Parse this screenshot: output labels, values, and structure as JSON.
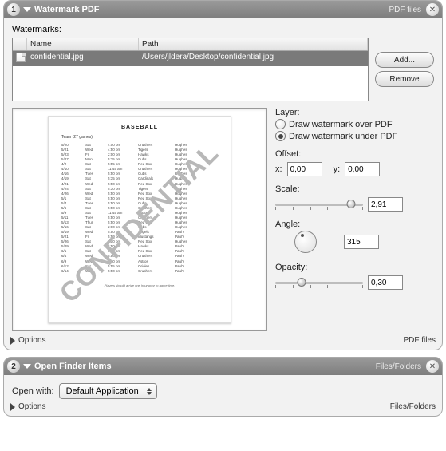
{
  "action1": {
    "step": "1",
    "title": "Watermark PDF",
    "type": "PDF files",
    "watermarks_label": "Watermarks:",
    "table": {
      "col_name": "Name",
      "col_path": "Path",
      "row": {
        "name": "confidential.jpg",
        "path": "/Users/jldera/Desktop/confidential.jpg"
      }
    },
    "buttons": {
      "add": "Add...",
      "remove": "Remove"
    },
    "layer": {
      "label": "Layer:",
      "over": "Draw watermark over PDF",
      "under": "Draw watermark under PDF",
      "selected": "under"
    },
    "offset": {
      "label": "Offset:",
      "x_label": "x:",
      "x": "0,00",
      "y_label": "y:",
      "y": "0,00"
    },
    "scale": {
      "label": "Scale:",
      "value": "2,91"
    },
    "angle": {
      "label": "Angle:",
      "value": "315"
    },
    "opacity": {
      "label": "Opacity:",
      "value": "0,30"
    },
    "options": "Options",
    "footer_type": "PDF files",
    "preview": {
      "title": "BASEBALL",
      "subtitle": "Team (27 games)",
      "watermark": "CONFIDENTIAL",
      "footnote": "Players should arrive one hour prior to game time.",
      "schedule": [
        [
          "5/20",
          "Sat",
          "4:00 pm",
          "Crushers",
          "Hughes"
        ],
        [
          "5/21",
          "Wed",
          "4:50 pm",
          "Tigers",
          "Hughes"
        ],
        [
          "5/23",
          "Fri",
          "2:00 pm",
          "Hawks",
          "Hughes"
        ],
        [
          "5/27",
          "Mon",
          "5:35 pm",
          "Cubs",
          "Hughes"
        ],
        [
          "4/2",
          "Sat",
          "5:55 pm",
          "Red Sox",
          "Hughes"
        ],
        [
          "4/10",
          "Sat",
          "11:45 am",
          "Crushers",
          "Hughes"
        ],
        [
          "4/16",
          "Tues",
          "5:50 pm",
          "Cubs",
          "Hughes"
        ],
        [
          "4/19",
          "Sat",
          "5:35 pm",
          "Cardinals",
          "Hughes"
        ],
        [
          "4/21",
          "Wed",
          "5:50 pm",
          "Red Sox",
          "Hughes"
        ],
        [
          "4/24",
          "Sat",
          "5:30 pm",
          "Tigers",
          "Hughes"
        ],
        [
          "4/26",
          "Wed",
          "5:50 pm",
          "Red Sox",
          "Hughes"
        ],
        [
          "5/1",
          "Sat",
          "5:50 pm",
          "Red Sox",
          "Hughes"
        ],
        [
          "5/4",
          "Tues",
          "5:50 pm",
          "Cubs",
          "Hughes"
        ],
        [
          "5/6",
          "Sat",
          "5:50 pm",
          "Crushers",
          "Hughes"
        ],
        [
          "5/9",
          "Sat",
          "11:45 am",
          "Astros",
          "Hughes"
        ],
        [
          "5/11",
          "Tues",
          "5:50 pm",
          "Crushers",
          "Hughes"
        ],
        [
          "5/13",
          "Thur",
          "5:50 pm",
          "Red Sox",
          "Hughes"
        ],
        [
          "5/16",
          "Sat",
          "2:00 pm",
          "Cubs",
          "Hughes"
        ],
        [
          "5/19",
          "Wed",
          "5:50 pm",
          "Angels",
          "Paul's"
        ],
        [
          "5/21",
          "Fri",
          "5:50 pm",
          "Mustangs",
          "Paul's"
        ],
        [
          "5/26",
          "Sat",
          "5:50 pm",
          "Red Sox",
          "Hughes"
        ],
        [
          "5/29",
          "Wed",
          "5:50 pm",
          "Hawks",
          "Paul's"
        ],
        [
          "6/1",
          "Sat",
          "5:35 pm",
          "Red Sox",
          "Paul's"
        ],
        [
          "6/4",
          "Wed",
          "5:50 pm",
          "Crushers",
          "Paul's"
        ],
        [
          "6/9",
          "Wed",
          "5:30 pm",
          "Astros",
          "Paul's"
        ],
        [
          "6/12",
          "Sat",
          "5:55 pm",
          "Orioles",
          "Paul's"
        ],
        [
          "6/14",
          "Wed",
          "5:50 pm",
          "Crushers",
          "Paul's"
        ]
      ]
    }
  },
  "action2": {
    "step": "2",
    "title": "Open Finder Items",
    "type": "Files/Folders",
    "open_with_label": "Open with:",
    "app": "Default Application",
    "options": "Options",
    "footer_type": "Files/Folders"
  }
}
